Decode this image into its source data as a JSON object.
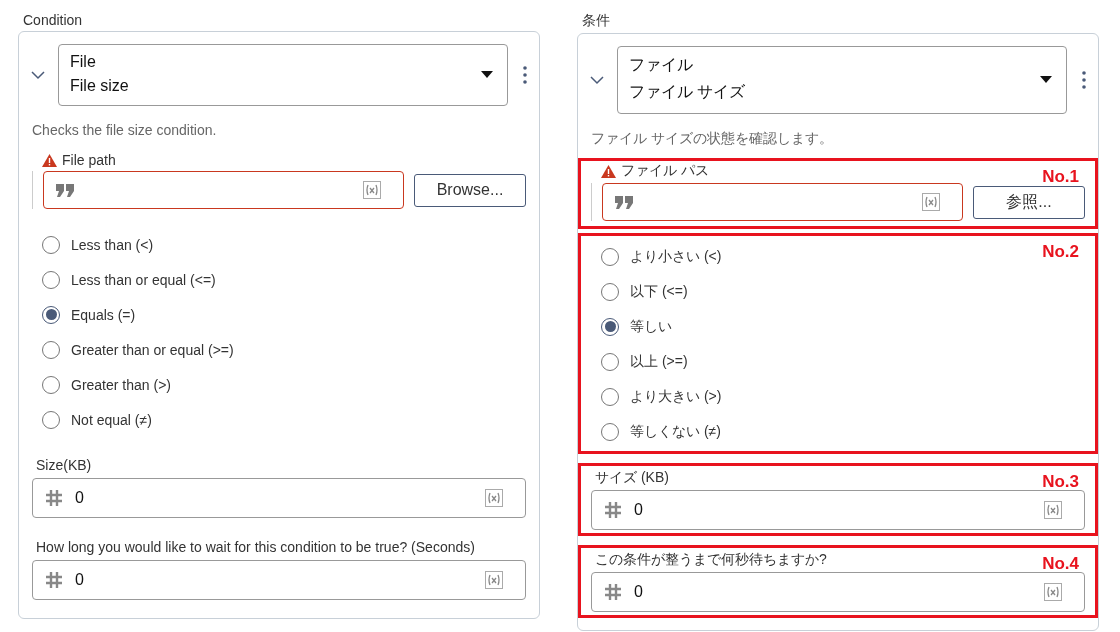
{
  "panels": [
    {
      "title": "Condition",
      "dropdown": {
        "category": "File",
        "action": "File size"
      },
      "description": "Checks the file size condition.",
      "file_path": {
        "label": "File path",
        "error": true,
        "button": "Browse..."
      },
      "options": {
        "items": [
          {
            "label": "Less than (<)",
            "selected": false
          },
          {
            "label": "Less than or equal (<=)",
            "selected": false
          },
          {
            "label": "Equals (=)",
            "selected": true
          },
          {
            "label": "Greater than or equal (>=)",
            "selected": false
          },
          {
            "label": "Greater than (>)",
            "selected": false
          },
          {
            "label": "Not equal (≠)",
            "selected": false
          }
        ]
      },
      "size": {
        "label": "Size(KB)",
        "value": "0"
      },
      "wait": {
        "label": "How long you would like to wait for this condition to be true? (Seconds)",
        "value": "0"
      }
    },
    {
      "title": "条件",
      "dropdown": {
        "category": "ファイル",
        "action": "ファイル サイズ"
      },
      "description": "ファイル サイズの状態を確認します。",
      "file_path": {
        "label": "ファイル パス",
        "error": true,
        "button": "参照...",
        "callout": "No.1"
      },
      "options": {
        "callout": "No.2",
        "items": [
          {
            "label": "より小さい (<)",
            "selected": false
          },
          {
            "label": "以下 (<=)",
            "selected": false
          },
          {
            "label": "等しい",
            "selected": true
          },
          {
            "label": "以上 (>=)",
            "selected": false
          },
          {
            "label": "より大きい (>)",
            "selected": false
          },
          {
            "label": "等しくない (≠)",
            "selected": false
          }
        ]
      },
      "size": {
        "label": "サイズ (KB)",
        "value": "0",
        "callout": "No.3"
      },
      "wait": {
        "label": "この条件が整うまで何秒待ちますか?",
        "value": "0",
        "callout": "No.4"
      }
    }
  ]
}
